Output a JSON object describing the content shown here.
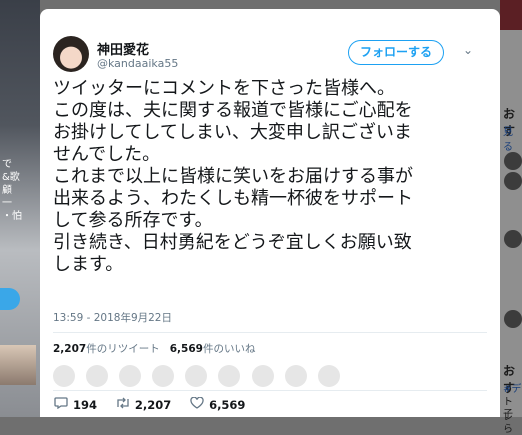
{
  "background": {
    "left_text": [
      "で",
      "&歌",
      "顧",
      "一",
      "・怕"
    ],
    "right_labels": [
      "おす",
      "見る",
      "おす",
      "#デ",
      "トレ",
      "子ら",
      "手国"
    ]
  },
  "tweet": {
    "author_name": "神田愛花",
    "author_handle": "@kandaaika55",
    "follow_label": "フォローする",
    "caret": "⌄",
    "lines": [
      "ツイッターにコメントを下さった皆様へ。",
      "この度は、夫に関する報道で皆様にご心配を",
      "お掛けしてしてしまい、大変申し訳ございま",
      "せんでした。",
      "これまで以上に皆様に笑いをお届けする事が",
      "出来るよう、わたくしも精一杯彼をサポート",
      "して参る所存です。",
      "引き続き、日村勇紀をどうぞ宜しくお願い致",
      "します。"
    ],
    "timestamp": "13:59 - 2018年9月22日",
    "retweets_count": "2,207",
    "retweets_label": "件のリツイート",
    "likes_count": "6,569",
    "likes_label": "件のいいね",
    "actions": {
      "reply_count": "194",
      "retweet_count": "2,207",
      "like_count": "6,569"
    },
    "accent_color": "#1da1f2"
  }
}
